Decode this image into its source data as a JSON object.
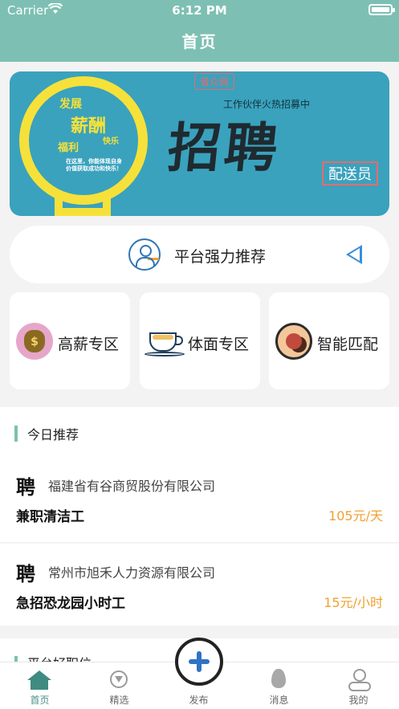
{
  "status": {
    "carrier": "Carrier",
    "time": "6:12 PM"
  },
  "nav": {
    "title": "首页"
  },
  "banner": {
    "words": [
      "发展",
      "薪酬",
      "福利",
      "快乐"
    ],
    "note": "在这里，你能体现自身价值获取成功和快乐！",
    "tag": "普众网",
    "subtitle": "工作伙伴火热招募中",
    "headline": "招聘",
    "role": "配送员"
  },
  "recommend": {
    "label": "平台强力推荐"
  },
  "categories": [
    {
      "label": "高薪专区",
      "icon": "money-bag-icon"
    },
    {
      "label": "体面专区",
      "icon": "coffee-cup-icon"
    },
    {
      "label": "智能匹配",
      "icon": "people-match-icon"
    }
  ],
  "today": {
    "title": "今日推荐",
    "jobs": [
      {
        "badge": "聘",
        "company": "福建省有谷商贸股份有限公司",
        "title": "兼职清洁工",
        "salary": "105元/天"
      },
      {
        "badge": "聘",
        "company": "常州市旭禾人力资源有限公司",
        "title": "急招恐龙园小时工",
        "salary": "15元/小时"
      }
    ]
  },
  "next_section": {
    "title": "平台好职位"
  },
  "tabbar": {
    "items": [
      {
        "label": "首页",
        "icon": "home-icon"
      },
      {
        "label": "精选",
        "icon": "diamond-icon"
      },
      {
        "label": "发布",
        "icon": "plus-icon"
      },
      {
        "label": "消息",
        "icon": "drop-icon"
      },
      {
        "label": "我的",
        "icon": "user-icon"
      }
    ]
  },
  "colors": {
    "primary": "#7dc0b3",
    "salary": "#f0a030",
    "accent_blue": "#2f73c5"
  }
}
